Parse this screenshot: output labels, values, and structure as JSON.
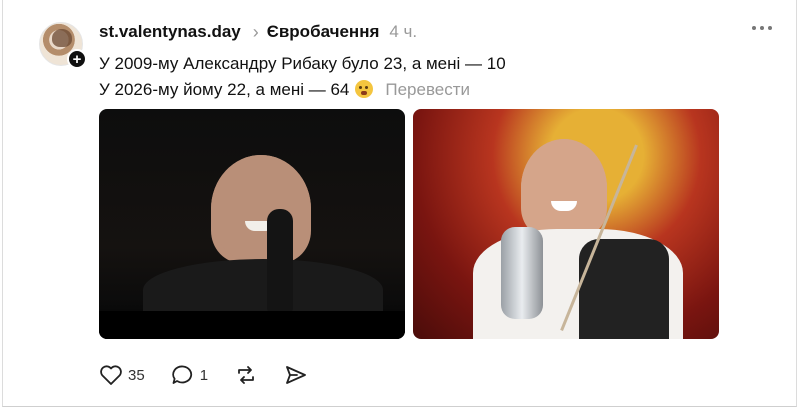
{
  "post": {
    "username": "st.valentynas.day",
    "topic": "Євробачення",
    "time": "4 ч.",
    "line1": "У 2009-му Александру Рибаку було 23, а мені — 10",
    "line2": "У 2026-му йому 22, а мені — 64",
    "emoji": "face-with-open-mouth",
    "translate_label": "Перевести"
  },
  "actions": {
    "likes": "35",
    "replies": "1"
  },
  "icons": [
    "avatar",
    "follow-plus-icon",
    "chevron-right-icon",
    "more-icon",
    "heart-icon",
    "comment-icon",
    "repost-icon",
    "share-icon"
  ]
}
